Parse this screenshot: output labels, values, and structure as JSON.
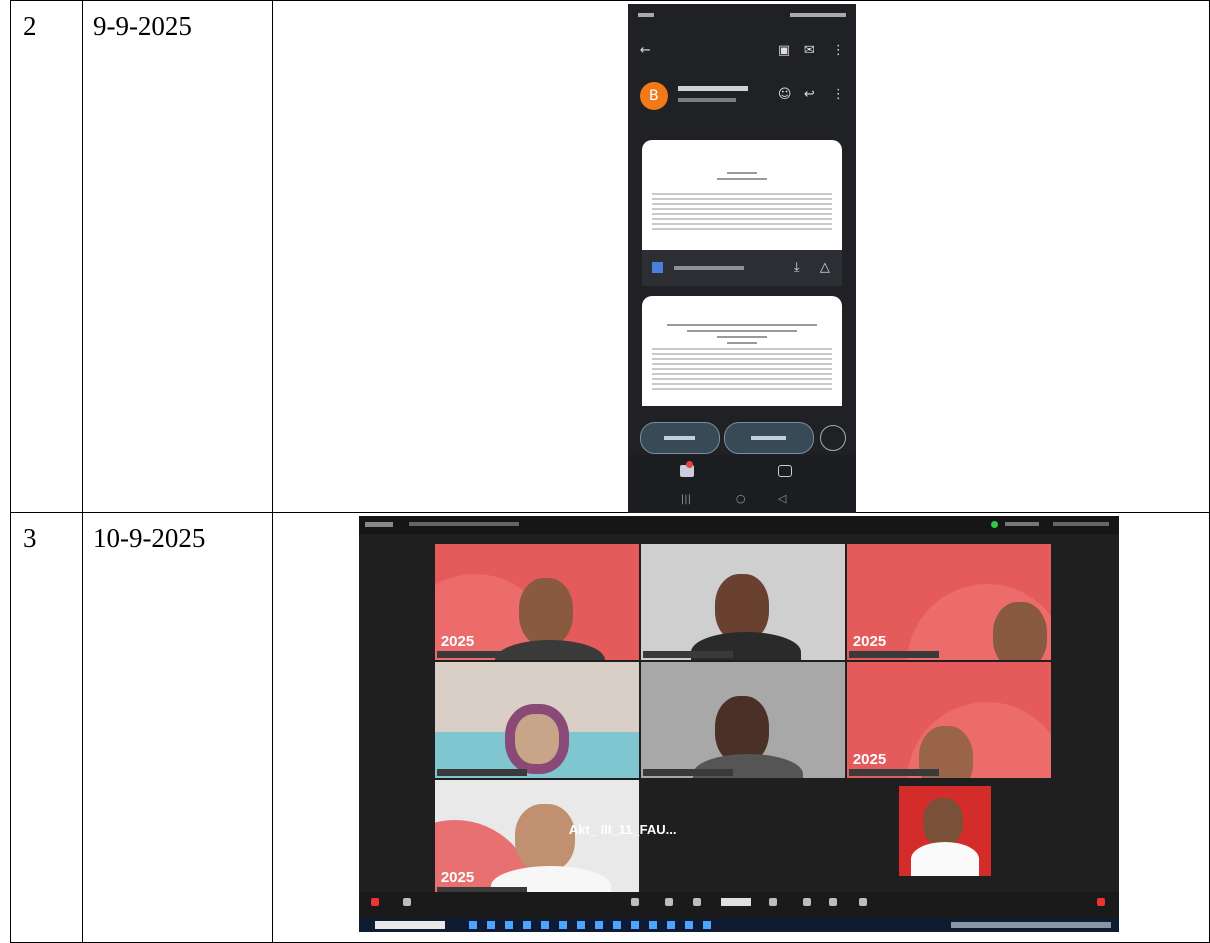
{
  "rows": [
    {
      "number": "2",
      "date": "9-9-2025"
    },
    {
      "number": "3",
      "date": "10-9-2025"
    }
  ],
  "phone_screenshot": {
    "avatar_letter": "B",
    "accent_color": "#f07a1a"
  },
  "zoom_screenshot": {
    "banner_year": "2025",
    "participant_name_tile": "Akt_ III_11_FAU..."
  }
}
